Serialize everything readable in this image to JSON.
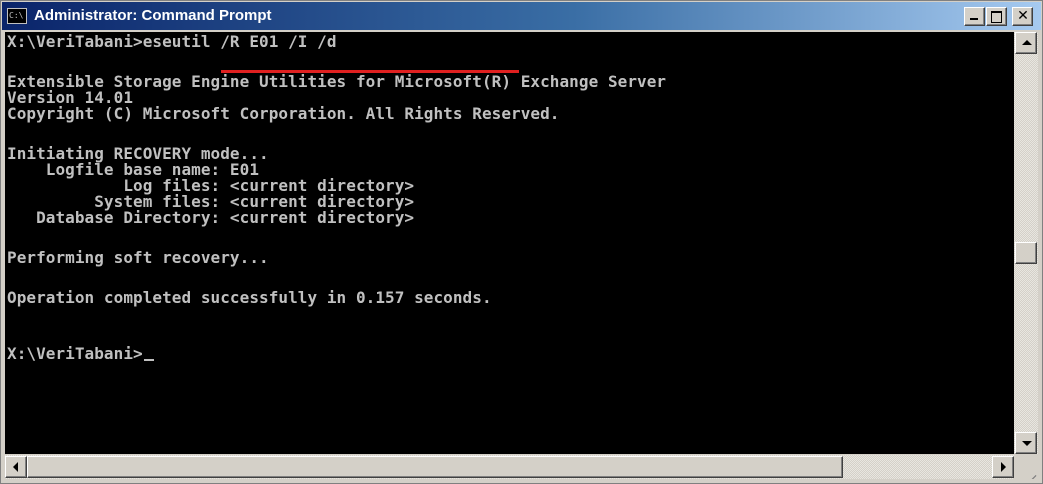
{
  "window": {
    "title": "Administrator: Command Prompt",
    "app_icon_text": "C:\\",
    "controls": {
      "minimize": "_",
      "maximize": "□",
      "close": "✕"
    }
  },
  "console": {
    "lines": [
      "X:\\VeriTabani>eseutil /R E01 /I /d",
      "",
      "Extensible Storage Engine Utilities for Microsoft(R) Exchange Server",
      "Version 14.01",
      "Copyright (C) Microsoft Corporation. All Rights Reserved.",
      "",
      "Initiating RECOVERY mode...",
      "    Logfile base name: E01",
      "            Log files: <current directory>",
      "         System files: <current directory>",
      "   Database Directory: <current directory>",
      "",
      "Performing soft recovery...",
      "",
      "Operation completed successfully in 0.157 seconds.",
      "",
      "",
      "X:\\VeriTabani>"
    ],
    "highlight_color": "#e02020",
    "text_color": "#c0c0c0",
    "background_color": "#000000"
  }
}
